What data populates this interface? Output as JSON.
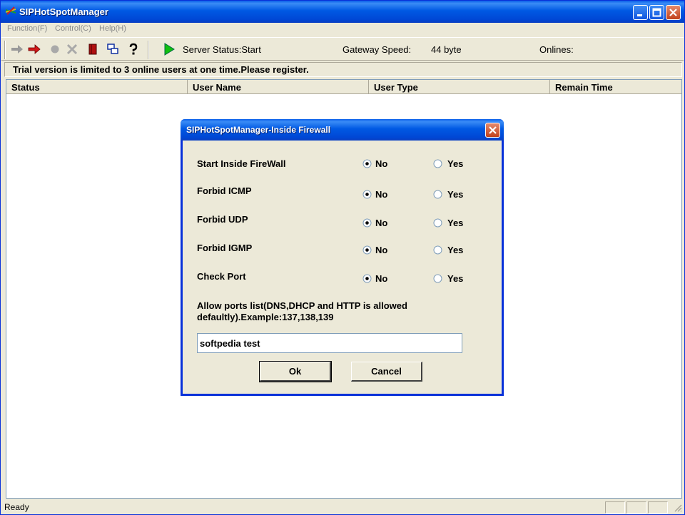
{
  "window": {
    "title": "SIPHotSpotManager"
  },
  "menu": {
    "items": [
      "Function(F)",
      "Control(C)",
      "Help(H)"
    ]
  },
  "toolbar": {
    "icons": [
      "forward-arrow-icon",
      "red-arrow-icon",
      "stop-dot-icon",
      "delete-x-icon",
      "book-icon",
      "windows-icon",
      "help-icon",
      "play-icon"
    ],
    "server_status": "Server Status:Start",
    "gateway_speed_label": "Gateway Speed:",
    "gateway_speed_value": "44 byte",
    "onlines_label": "Onlines:"
  },
  "notice": "Trial version is limited to 3 online users at one time.Please register.",
  "list": {
    "columns": [
      "Status",
      "User Name",
      "User Type",
      "Remain Time"
    ]
  },
  "statusbar": {
    "text": "Ready"
  },
  "dialog": {
    "title": "SIPHotSpotManager-Inside Firewall",
    "rows": [
      {
        "label": "Start Inside FireWall",
        "selected": "No"
      },
      {
        "label": "Forbid ICMP",
        "selected": "No"
      },
      {
        "label": "Forbid UDP",
        "selected": "No"
      },
      {
        "label": "Forbid IGMP",
        "selected": "No"
      },
      {
        "label": "Check Port",
        "selected": "No"
      }
    ],
    "option_no": "No",
    "option_yes": "Yes",
    "ports_label": "Allow ports list(DNS,DHCP and HTTP is allowed defaultly).Example:137,138,139",
    "ports_value": "softpedia test",
    "ok_label": "Ok",
    "cancel_label": "Cancel"
  },
  "colors": {
    "titlebar": "#0054e3",
    "close": "#d5522a",
    "face": "#ece9d8"
  }
}
